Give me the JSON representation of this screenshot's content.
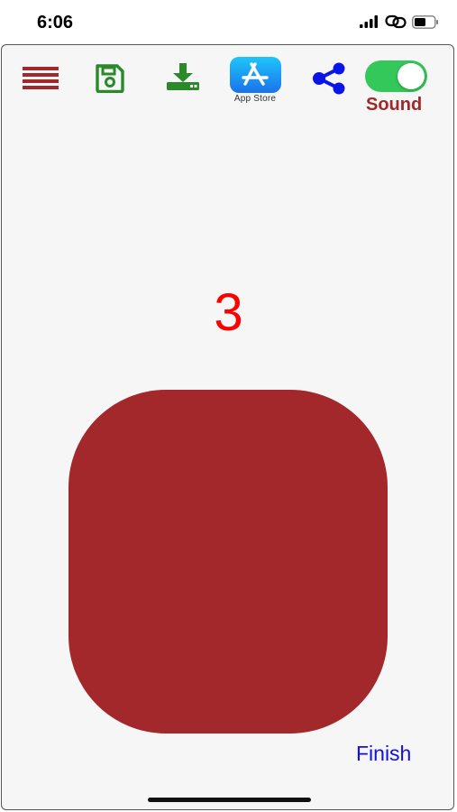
{
  "status_bar": {
    "time": "6:06"
  },
  "toolbar": {
    "menu_icon": "hamburger-menu-icon",
    "save_icon": "floppy-disk-icon",
    "download_icon": "download-icon",
    "app_store_label": "App Store",
    "share_icon": "share-icon",
    "sound_label": "Sound",
    "sound_enabled": true
  },
  "main": {
    "count": "3",
    "finish_label": "Finish"
  },
  "colors": {
    "accent_red": "#a2282b",
    "count_red": "#ff0000",
    "toolbar_green": "#2a8a2a",
    "share_blue": "#0a14e6",
    "finish_blue": "#1010e0",
    "toggle_green": "#34c759"
  }
}
